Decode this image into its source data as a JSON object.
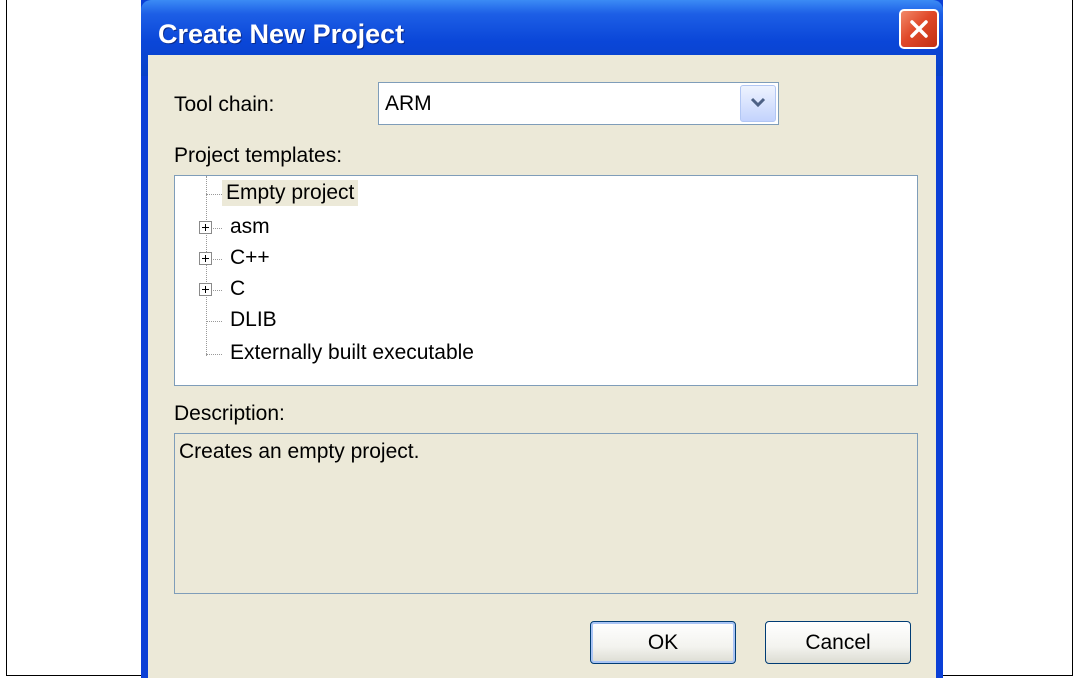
{
  "dialog": {
    "title": "Create New Project"
  },
  "toolchain": {
    "label": "Tool chain:",
    "value": "ARM"
  },
  "templates": {
    "label": "Project templates:",
    "items": [
      {
        "label": "Empty project",
        "expandable": false,
        "selected": true
      },
      {
        "label": "asm",
        "expandable": true,
        "selected": false
      },
      {
        "label": "C++",
        "expandable": true,
        "selected": false
      },
      {
        "label": "C",
        "expandable": true,
        "selected": false
      },
      {
        "label": "DLIB",
        "expandable": false,
        "selected": false
      },
      {
        "label": "Externally built executable",
        "expandable": false,
        "selected": false
      }
    ]
  },
  "description": {
    "label": "Description:",
    "text": "Creates an empty project."
  },
  "buttons": {
    "ok": "OK",
    "cancel": "Cancel"
  },
  "icons": {
    "close": "close-icon",
    "dropdown": "chevron-down-icon",
    "expand": "plus-box-icon"
  }
}
